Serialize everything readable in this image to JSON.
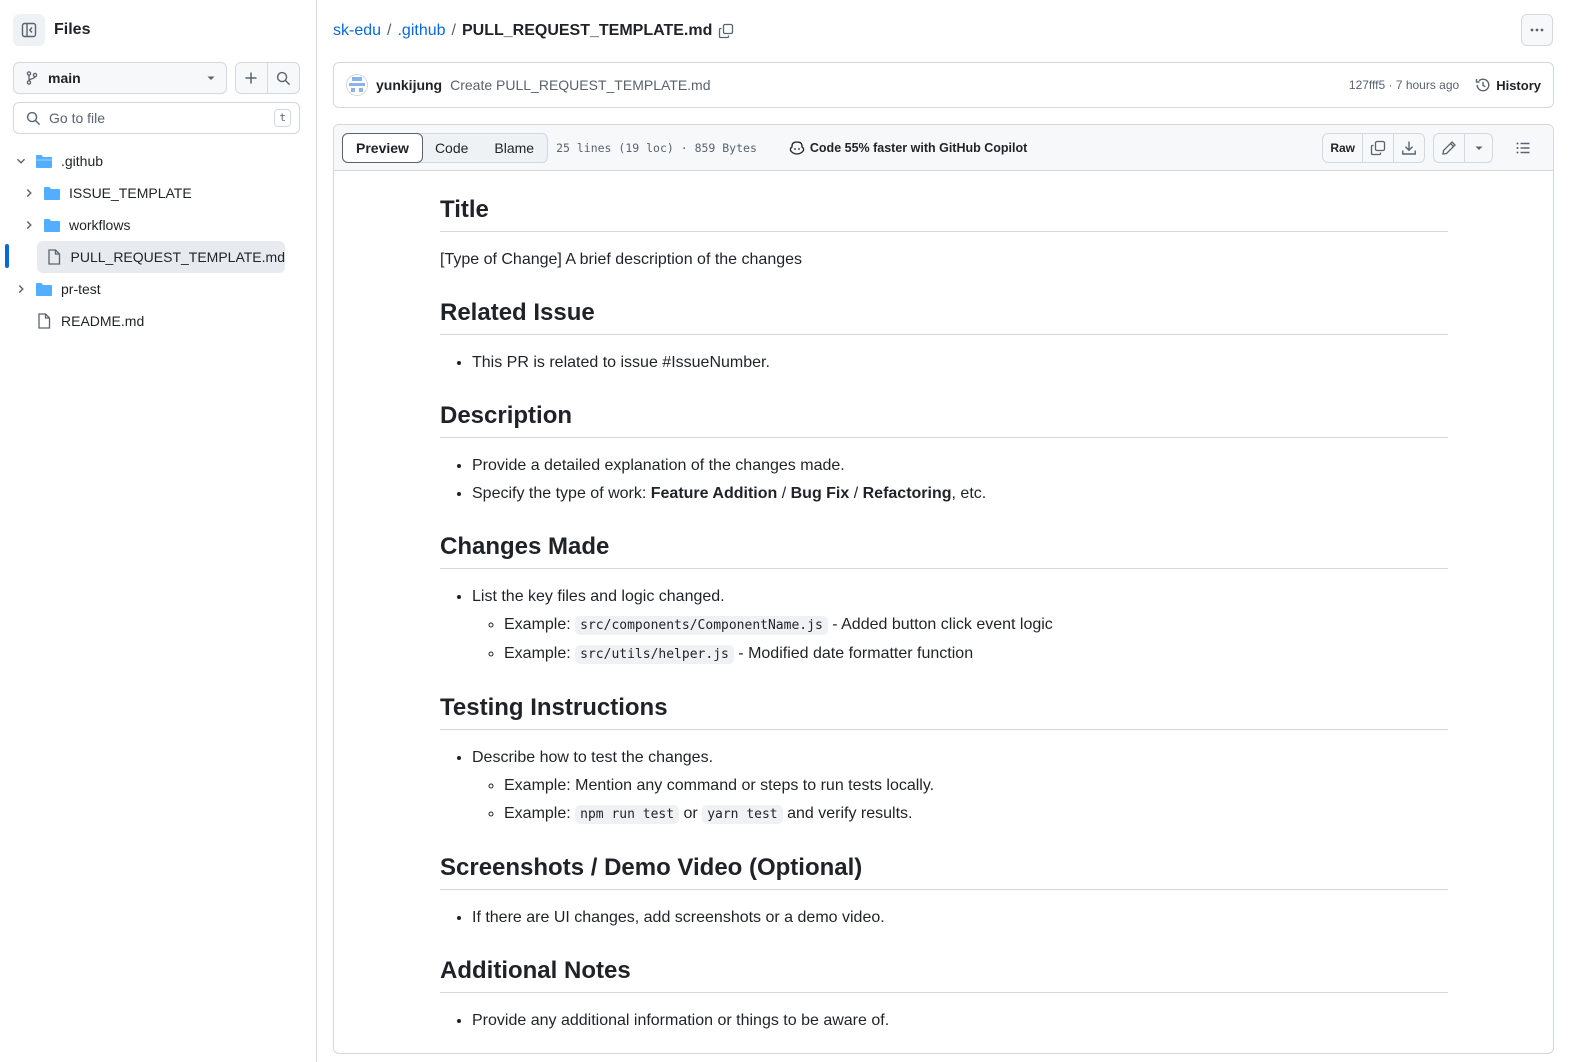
{
  "sidebar": {
    "title": "Files",
    "branch": "main",
    "goto_placeholder": "Go to file",
    "goto_shortcut": "t",
    "tree": [
      {
        "label": ".github",
        "type": "folder",
        "expanded": true
      },
      {
        "label": "ISSUE_TEMPLATE",
        "type": "folder",
        "expanded": false
      },
      {
        "label": "workflows",
        "type": "folder",
        "expanded": false
      },
      {
        "label": "PULL_REQUEST_TEMPLATE.md",
        "type": "file",
        "selected": true
      },
      {
        "label": "pr-test",
        "type": "folder",
        "expanded": false
      },
      {
        "label": "README.md",
        "type": "file"
      }
    ]
  },
  "breadcrumb": {
    "repo": "sk-edu",
    "folder": ".github",
    "file": "PULL_REQUEST_TEMPLATE.md"
  },
  "commit": {
    "author": "yunkijung",
    "message": "Create PULL_REQUEST_TEMPLATE.md",
    "meta": "127fff5 · 7 hours ago",
    "history_label": "History"
  },
  "file_header": {
    "tabs": [
      "Preview",
      "Code",
      "Blame"
    ],
    "active_tab": "Preview",
    "meta": "25 lines (19 loc) · 859 Bytes",
    "copilot": "Code 55% faster with GitHub Copilot",
    "raw_label": "Raw"
  },
  "content": {
    "h_title": "Title",
    "p_title": "[Type of Change] A brief description of the changes",
    "h_related": "Related Issue",
    "related_item": "This PR is related to issue #IssueNumber.",
    "h_desc": "Description",
    "desc_item1": "Provide a detailed explanation of the changes made.",
    "desc_item2_prefix": "Specify the type of work: ",
    "desc_item2_b1": "Feature Addition",
    "desc_item2_sep1": " / ",
    "desc_item2_b2": "Bug Fix",
    "desc_item2_sep2": " / ",
    "desc_item2_b3": "Refactoring",
    "desc_item2_suffix": ", etc.",
    "h_changes": "Changes Made",
    "changes_item": "List the key files and logic changed.",
    "changes_sub1_prefix": "Example: ",
    "changes_sub1_code": "src/components/ComponentName.js",
    "changes_sub1_suffix": " - Added button click event logic",
    "changes_sub2_prefix": "Example: ",
    "changes_sub2_code": "src/utils/helper.js",
    "changes_sub2_suffix": " - Modified date formatter function",
    "h_testing": "Testing Instructions",
    "testing_item": "Describe how to test the changes.",
    "testing_sub1": "Example: Mention any command or steps to run tests locally.",
    "testing_sub2_prefix": "Example: ",
    "testing_sub2_code1": "npm run test",
    "testing_sub2_mid": " or ",
    "testing_sub2_code2": "yarn test",
    "testing_sub2_suffix": " and verify results.",
    "h_screens": "Screenshots / Demo Video (Optional)",
    "screens_item": "If there are UI changes, add screenshots or a demo video.",
    "h_notes": "Additional Notes",
    "notes_item": "Provide any additional information or things to be aware of."
  },
  "colors": {
    "link": "#0969da",
    "folder": "#54aeff",
    "border": "#d1d9e0",
    "muted": "#59636e"
  }
}
